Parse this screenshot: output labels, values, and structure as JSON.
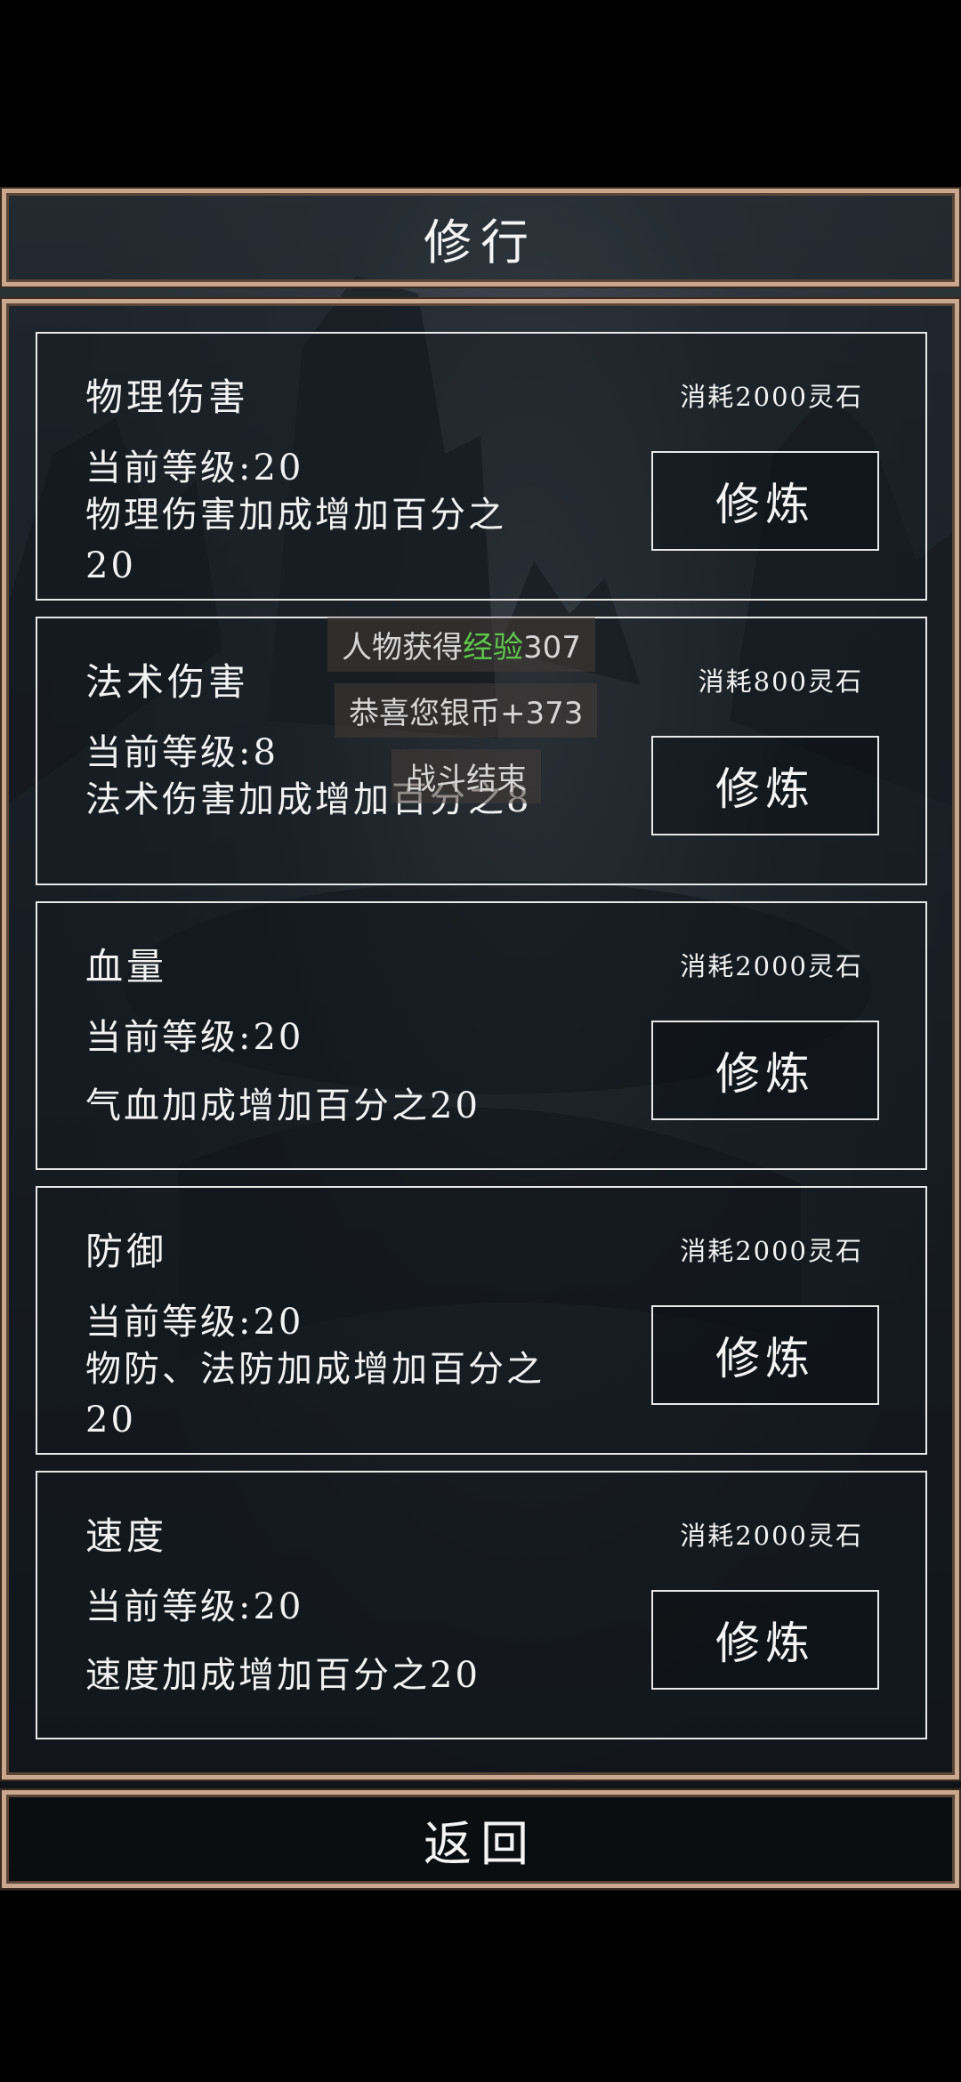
{
  "header": {
    "title": "修行"
  },
  "cards": [
    {
      "title": "物理伤害",
      "cost": "消耗2000灵石",
      "level": "当前等级:20",
      "desc": "物理伤害加成增加百分之20",
      "button": "修炼"
    },
    {
      "title": "法术伤害",
      "cost": "消耗800灵石",
      "level": "当前等级:8",
      "desc": "法术伤害加成增加百分之8",
      "button": "修炼"
    },
    {
      "title": "血量",
      "cost": "消耗2000灵石",
      "level": "当前等级:20",
      "desc": "气血加成增加百分之20",
      "button": "修炼"
    },
    {
      "title": "防御",
      "cost": "消耗2000灵石",
      "level": "当前等级:20",
      "desc": "物防、法防加成增加百分之20",
      "button": "修炼"
    },
    {
      "title": "速度",
      "cost": "消耗2000灵石",
      "level": "当前等级:20",
      "desc": "速度加成增加百分之20",
      "button": "修炼"
    }
  ],
  "toasts": {
    "exp_prefix": "人物获得",
    "exp_highlight": "经验",
    "exp_value": "307",
    "silver": "恭喜您银币+373",
    "battle_end": "战斗结束"
  },
  "footer": {
    "back_label": "返回"
  },
  "colors": {
    "frame": "#c9a88f",
    "highlight": "#5ec84a",
    "text": "#f2f2f2"
  }
}
